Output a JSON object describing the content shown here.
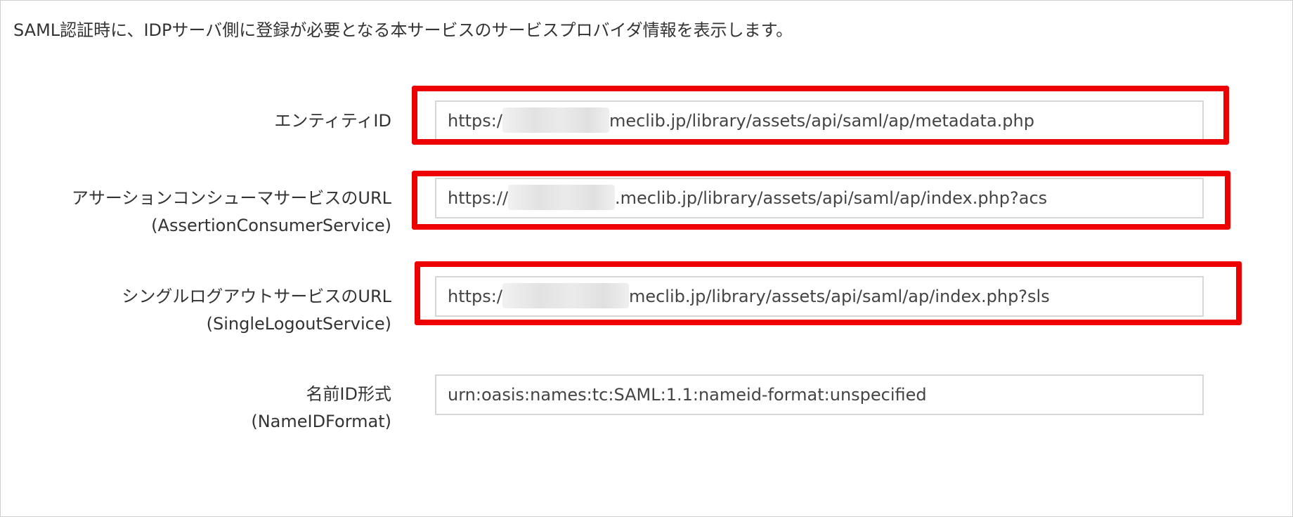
{
  "intro_text": "SAML認証時に、IDPサーバ側に登録が必要となる本サービスのサービスプロバイダ情報を表示します。",
  "rows": [
    {
      "label": "エンティティID",
      "sublabel": "",
      "value_prefix": "https:/",
      "value_suffix": "meclib.jp/library/assets/api/saml/ap/metadata.php",
      "highlighted": true
    },
    {
      "label": "アサーションコンシューマサービスのURL",
      "sublabel": "(AssertionConsumerService)",
      "value_prefix": "https://",
      "value_suffix": ".meclib.jp/library/assets/api/saml/ap/index.php?acs",
      "highlighted": true
    },
    {
      "label": "シングルログアウトサービスのURL",
      "sublabel": "(SingleLogoutService)",
      "value_prefix": "https:/",
      "value_suffix": "meclib.jp/library/assets/api/saml/ap/index.php?sls",
      "highlighted": true
    },
    {
      "label": "名前ID形式",
      "sublabel": "(NameIDFormat)",
      "value_prefix": "",
      "value_suffix": "urn:oasis:names:tc:SAML:1.1:nameid-format:unspecified",
      "highlighted": false
    }
  ],
  "colors": {
    "highlight_border": "#ee0000",
    "field_border": "#d6d6d6",
    "text": "#333333"
  }
}
